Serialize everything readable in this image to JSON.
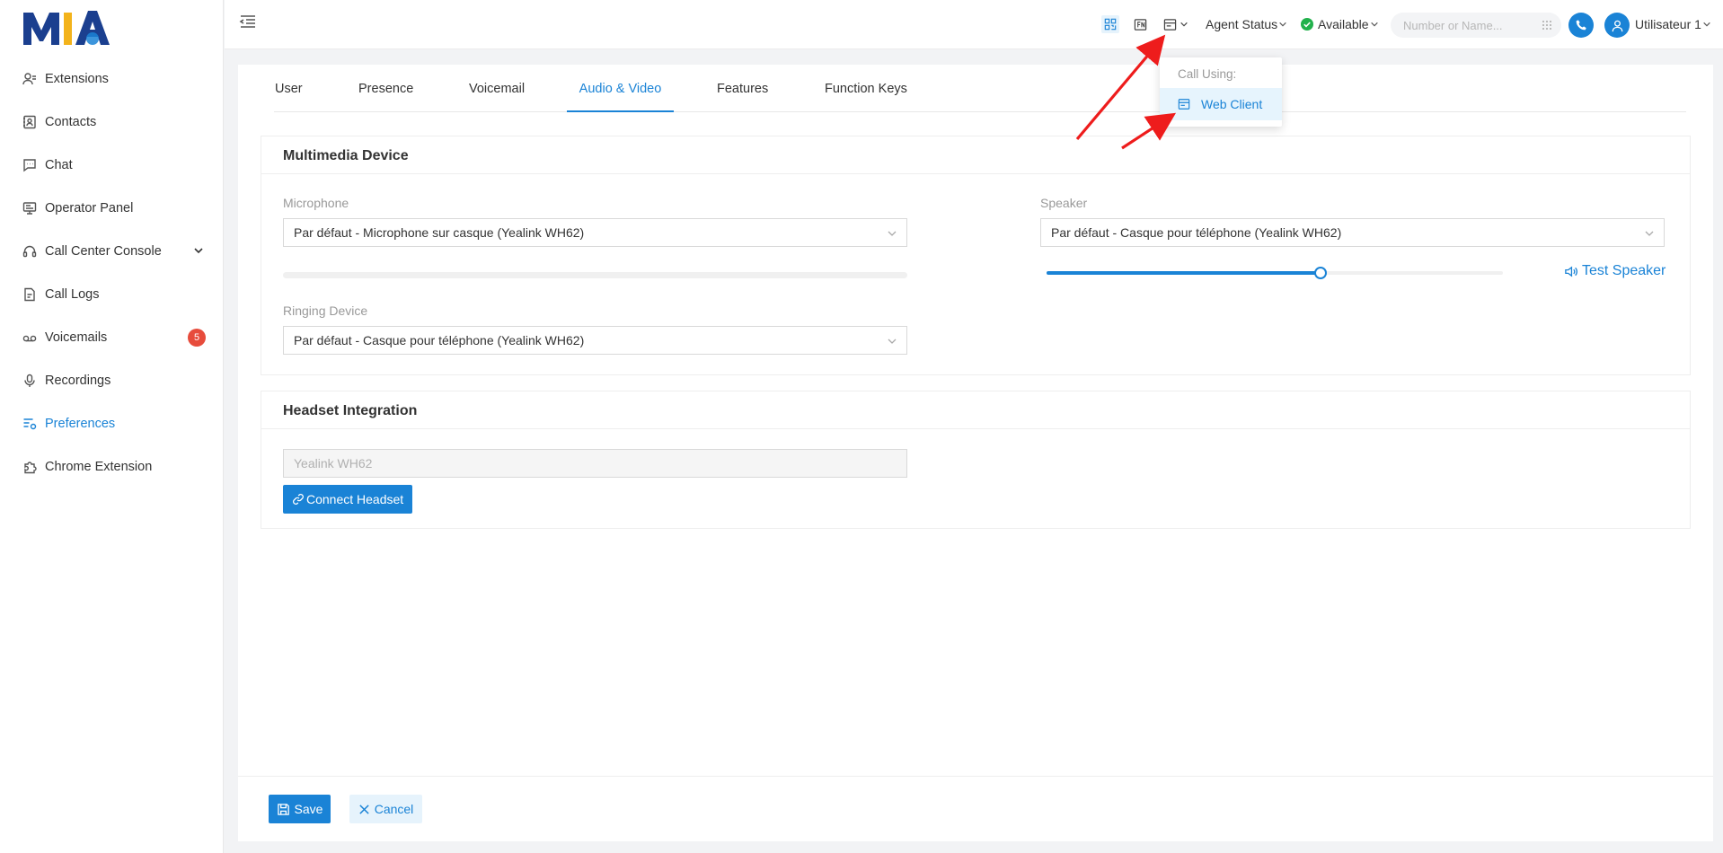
{
  "brand": {
    "logo_text": "MIA",
    "colors": {
      "primary": "#1a83d6",
      "badge": "#e74c3c",
      "logo_blue": "#1b3f8f",
      "logo_yellow": "#f3b31b",
      "annotation_red": "#ee1c1c",
      "status_green": "#22b14c"
    }
  },
  "sidebar": {
    "items": [
      {
        "label": "Extensions",
        "icon": "user-list-icon"
      },
      {
        "label": "Contacts",
        "icon": "contacts-book-icon"
      },
      {
        "label": "Chat",
        "icon": "chat-bubble-icon"
      },
      {
        "label": "Operator Panel",
        "icon": "monitor-icon"
      },
      {
        "label": "Call Center Console",
        "icon": "headset-icon"
      },
      {
        "label": "Call Logs",
        "icon": "call-log-icon"
      },
      {
        "label": "Voicemails",
        "icon": "voicemail-icon",
        "badge": "5"
      },
      {
        "label": "Recordings",
        "icon": "microphone-icon"
      },
      {
        "label": "Preferences",
        "icon": "preferences-icon",
        "active": true
      },
      {
        "label": "Chrome Extension",
        "icon": "puzzle-icon"
      }
    ]
  },
  "header": {
    "agent_status": "Agent Status",
    "availability": "Available",
    "search_placeholder": "Number or Name...",
    "user_name": "Utilisateur 1"
  },
  "call_using_menu": {
    "label": "Call Using:",
    "selected": "Web Client"
  },
  "tabs": [
    "User",
    "Presence",
    "Voicemail",
    "Audio & Video",
    "Features",
    "Function Keys"
  ],
  "active_tab": "Audio & Video",
  "multimedia": {
    "title": "Multimedia Device",
    "microphone_label": "Microphone",
    "microphone_value": "Par défaut - Microphone sur casque (Yealink WH62)",
    "speaker_label": "Speaker",
    "speaker_value": "Par défaut - Casque pour téléphone (Yealink WH62)",
    "speaker_volume": 0.6,
    "test_speaker": "Test Speaker",
    "ringing_label": "Ringing Device",
    "ringing_value": "Par défaut - Casque pour téléphone (Yealink WH62)"
  },
  "headset": {
    "title": "Headset Integration",
    "placeholder": "Yealink WH62",
    "connect_button": "Connect Headset"
  },
  "footer": {
    "save": "Save",
    "cancel": "Cancel"
  }
}
